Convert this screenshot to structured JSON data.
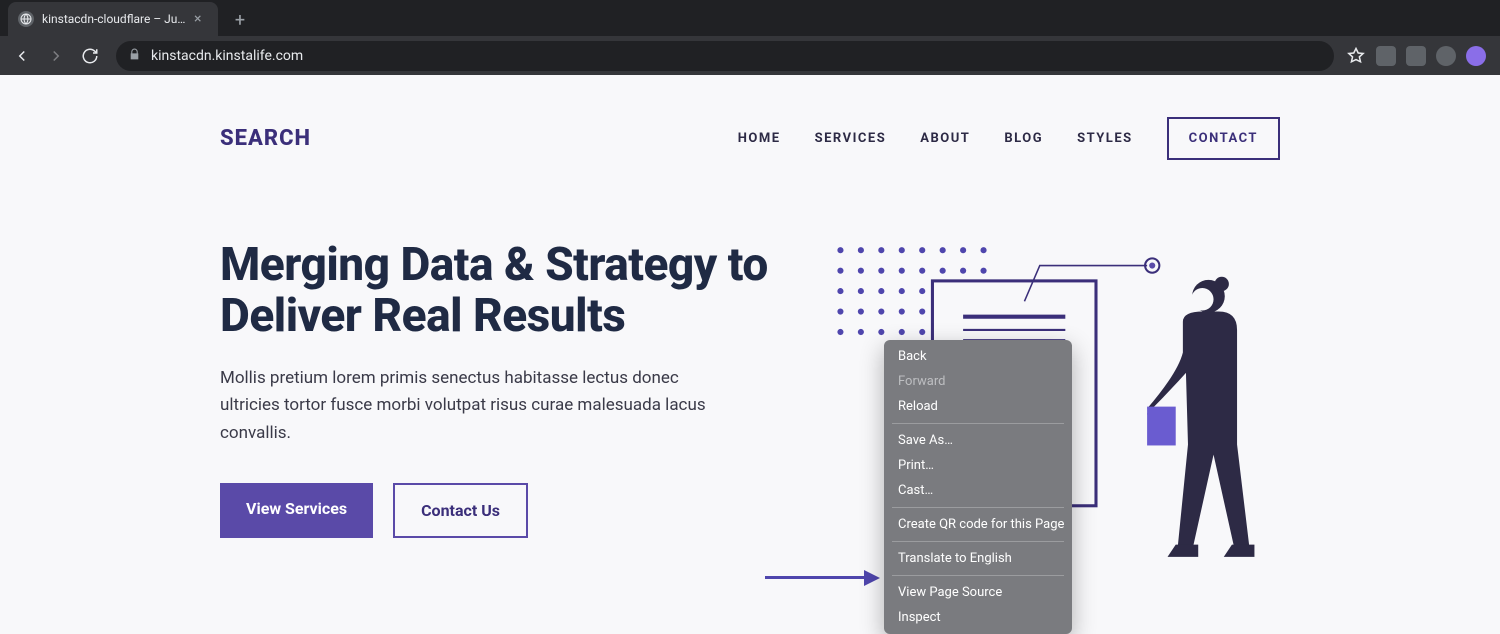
{
  "browser": {
    "tab_title": "kinstacdn-cloudflare – Just an…",
    "url": "kinstacdn.kinstalife.com"
  },
  "site": {
    "logo": "SEARCH",
    "nav": {
      "home": "HOME",
      "services": "SERVICES",
      "about": "ABOUT",
      "blog": "BLOG",
      "styles": "STYLES",
      "contact": "CONTACT"
    }
  },
  "hero": {
    "headline": "Merging Data & Strategy to Deliver Real Results",
    "body": "Mollis pretium lorem primis senectus habitasse lectus donec ultricies tortor fusce morbi volutpat risus curae malesuada lacus convallis.",
    "cta_primary": "View Services",
    "cta_secondary": "Contact Us"
  },
  "context_menu": {
    "back": "Back",
    "forward": "Forward",
    "reload": "Reload",
    "save_as": "Save As…",
    "print": "Print…",
    "cast": "Cast…",
    "qr": "Create QR code for this Page",
    "translate": "Translate to English",
    "view_source": "View Page Source",
    "inspect": "Inspect"
  },
  "colors": {
    "brand_dark": "#1f2a44",
    "brand_purple": "#5a4aa8",
    "brand_indigo": "#3b2f7a"
  }
}
